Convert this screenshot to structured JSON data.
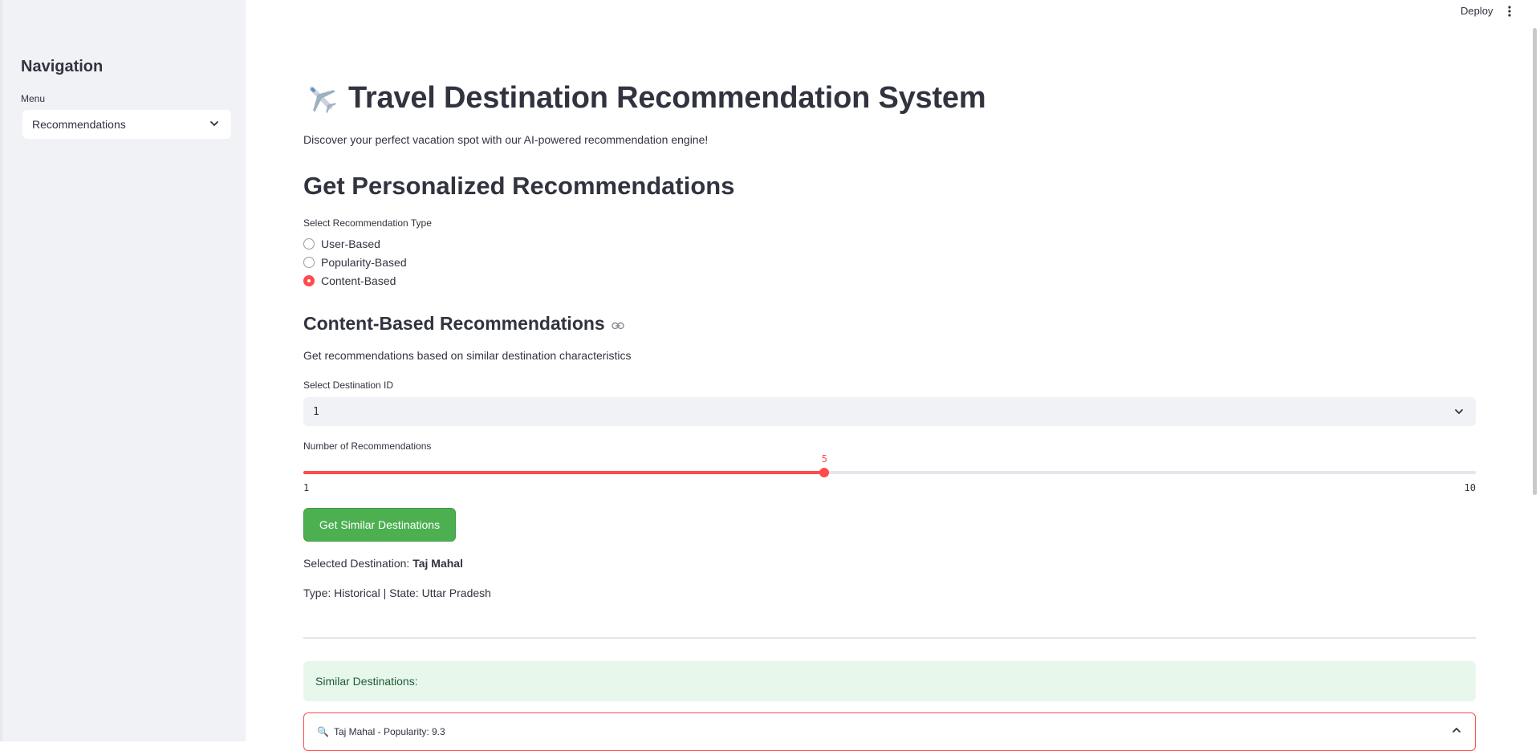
{
  "sidebar": {
    "title": "Navigation",
    "menu_label": "Menu",
    "menu_value": "Recommendations"
  },
  "header": {
    "deploy_label": "Deploy"
  },
  "main": {
    "title": "Travel Destination Recommendation System",
    "title_icon": "airplane-icon",
    "subtitle": "Discover your perfect vacation spot with our AI-powered recommendation engine!",
    "section_title": "Get Personalized Recommendations",
    "radio_label": "Select Recommendation Type",
    "radio_options": [
      "User-Based",
      "Popularity-Based",
      "Content-Based"
    ],
    "radio_selected": "Content-Based",
    "content_section_title": "Content-Based Recommendations",
    "content_section_desc": "Get recommendations based on similar destination characteristics",
    "destination_label": "Select Destination ID",
    "destination_value": "1",
    "slider": {
      "label": "Number of Recommendations",
      "value": "5",
      "min": "1",
      "max": "10"
    },
    "button_label": "Get Similar Destinations",
    "selected_destination_prefix": "Selected Destination:",
    "selected_destination_name": "Taj Mahal",
    "type_state": "Type: Historical | State: Uttar Pradesh",
    "similar_header": "Similar Destinations:",
    "expander_title": "Taj Mahal - Popularity: 9.3"
  },
  "colors": {
    "accent": "#ff4b4b",
    "button_green": "#4caf50",
    "success_bg": "#e8f7ec",
    "sidebar_bg": "#f0f2f6"
  }
}
